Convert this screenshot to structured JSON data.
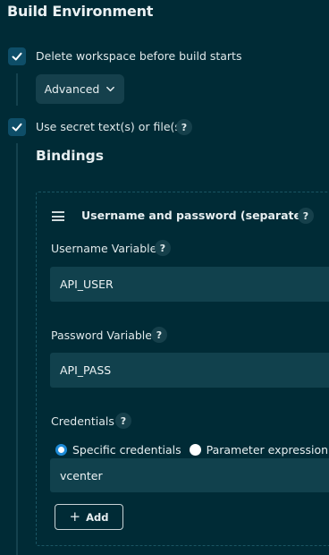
{
  "section": {
    "title": "Build Environment"
  },
  "options": {
    "delete_workspace": {
      "label": "Delete workspace before build starts",
      "checked": true
    },
    "advanced_label": "Advanced",
    "secret_text": {
      "label": "Use secret text(s) or file(s)",
      "checked": true,
      "help": "?"
    }
  },
  "bindings": {
    "title": "Bindings",
    "binding": {
      "title": "Username and password (separated)",
      "help": "?",
      "username_variable": {
        "label": "Username Variable",
        "help": "?",
        "value": "API_USER"
      },
      "password_variable": {
        "label": "Password Variable",
        "help": "?",
        "value": "API_PASS"
      },
      "credentials": {
        "label": "Credentials",
        "help": "?",
        "options": [
          {
            "label": "Specific credentials",
            "selected": true
          },
          {
            "label": "Parameter expression",
            "selected": false
          }
        ],
        "selected_value": "vcenter"
      }
    },
    "add_label": "Add",
    "add_icon": "+"
  },
  "colors": {
    "background": "#002b36",
    "checkbox": "#0e4e68",
    "input": "#11414d",
    "accent_radio": "#1d8ad6"
  }
}
